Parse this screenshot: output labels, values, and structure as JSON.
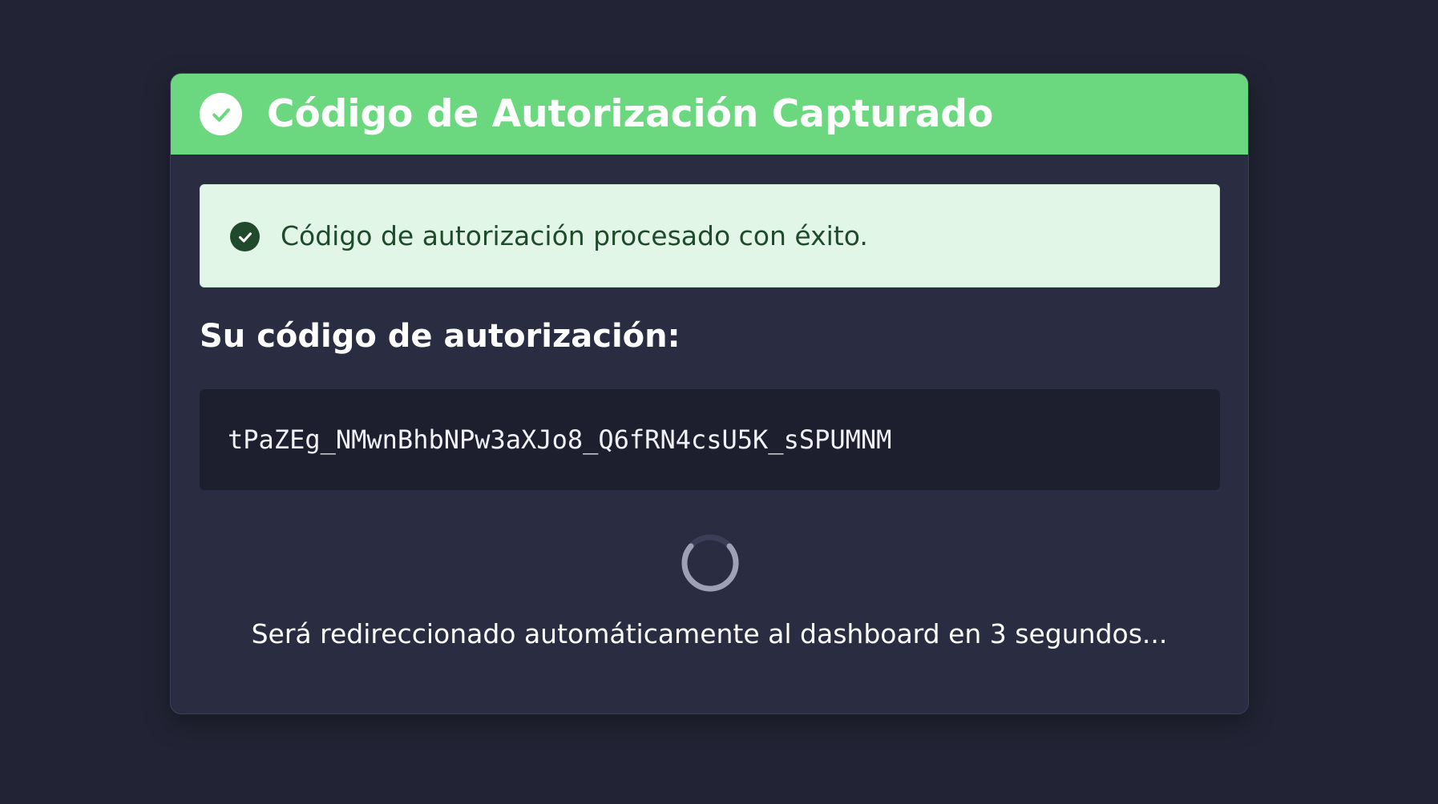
{
  "header": {
    "title": "Código de Autorización Capturado",
    "icon": "check-circle-icon",
    "background_color": "#6bd87f"
  },
  "alert": {
    "message": "Código de autorización procesado con éxito.",
    "icon": "check-circle-icon",
    "background_color": "#e1f6e6",
    "text_color": "#1f4b2c"
  },
  "code_section": {
    "heading": "Su código de autorización:",
    "code": "tPaZEg_NMwnBhbNPw3aXJo8_Q6fRN4csU5K_sSPUMNM"
  },
  "redirect": {
    "icon": "loading-spinner-icon",
    "message": "Será redireccionado automáticamente al dashboard en 3 segundos..."
  }
}
